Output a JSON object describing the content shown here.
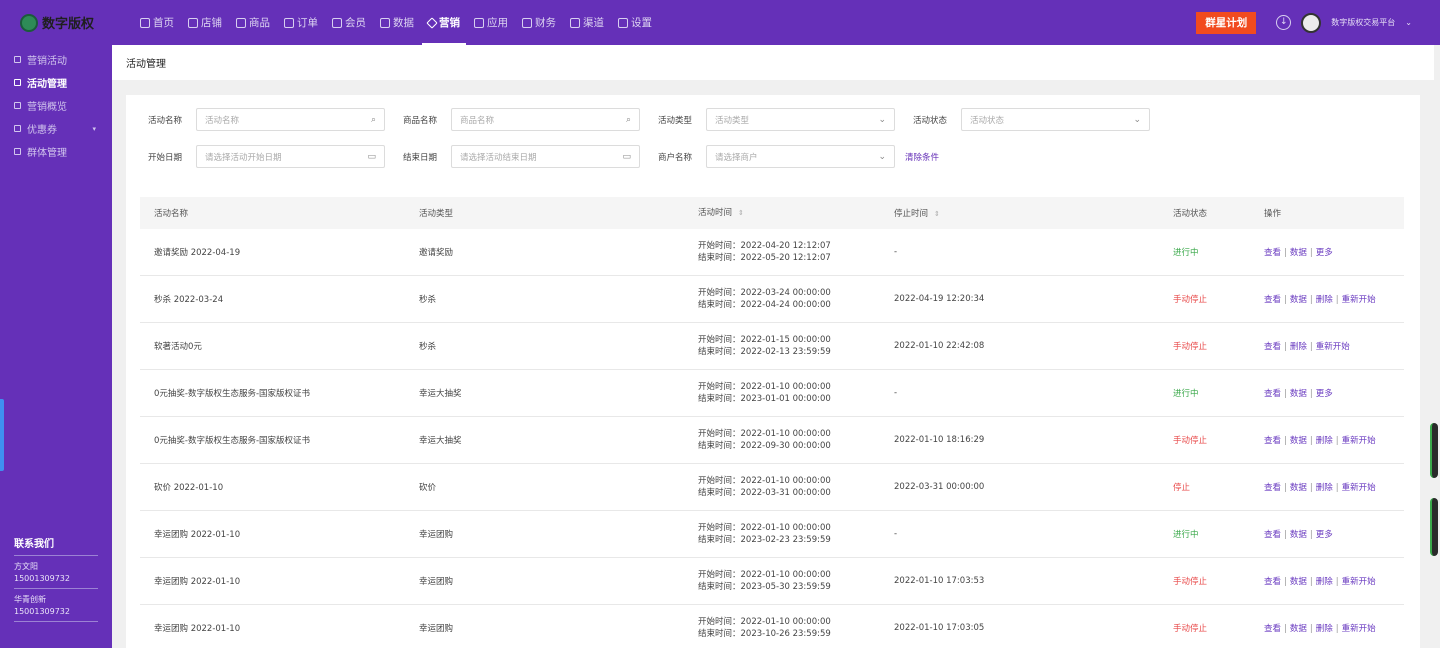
{
  "brand": {
    "name": "数字版权"
  },
  "nav": [
    {
      "label": "首页",
      "icon": "home-icon"
    },
    {
      "label": "店铺",
      "icon": "store-icon"
    },
    {
      "label": "商品",
      "icon": "goods-icon"
    },
    {
      "label": "订单",
      "icon": "order-icon"
    },
    {
      "label": "会员",
      "icon": "member-icon"
    },
    {
      "label": "数据",
      "icon": "data-icon"
    },
    {
      "label": "营销",
      "icon": "tag-icon",
      "active": true
    },
    {
      "label": "应用",
      "icon": "app-icon"
    },
    {
      "label": "财务",
      "icon": "finance-icon"
    },
    {
      "label": "渠道",
      "icon": "channel-icon"
    },
    {
      "label": "设置",
      "icon": "gear-icon"
    }
  ],
  "header_right": {
    "plan_button": "群星计划",
    "platform": "数字版权交易平台",
    "chevron": "⌄"
  },
  "sidebar": {
    "items": [
      {
        "label": "营销活动",
        "icon": "tag-icon"
      },
      {
        "label": "活动管理",
        "icon": "grid-icon",
        "active": true
      },
      {
        "label": "营销概览",
        "icon": "chart-icon"
      },
      {
        "label": "优惠券",
        "icon": "coupon-icon",
        "has_caret": true
      },
      {
        "label": "群体管理",
        "icon": "group-icon"
      }
    ],
    "contact": {
      "title": "联系我们",
      "people": [
        {
          "name": "方文阳",
          "phone": "15001309732"
        },
        {
          "name": "华青创新",
          "phone": "15001309732"
        }
      ]
    }
  },
  "page_title": "活动管理",
  "filters": {
    "row1": [
      {
        "label": "活动名称",
        "placeholder": "活动名称",
        "icon": "search-icon"
      },
      {
        "label": "商品名称",
        "placeholder": "商品名称",
        "icon": "search-icon"
      },
      {
        "label": "活动类型",
        "placeholder": "活动类型",
        "icon": "chevron-down-icon"
      },
      {
        "label": "活动状态",
        "placeholder": "活动状态",
        "icon": "chevron-down-icon"
      }
    ],
    "row2": [
      {
        "label": "开始日期",
        "placeholder": "请选择活动开始日期",
        "icon": "calendar-icon"
      },
      {
        "label": "结束日期",
        "placeholder": "请选择活动结束日期",
        "icon": "calendar-icon"
      },
      {
        "label": "商户名称",
        "placeholder": "请选择商户",
        "icon": "chevron-down-icon"
      }
    ],
    "clear": "清除条件"
  },
  "table": {
    "headers": [
      "活动名称",
      "活动类型",
      "活动时间",
      "停止时间",
      "活动状态",
      "操作"
    ],
    "rows": [
      {
        "name": "邀请奖励 2022-04-19",
        "type": "邀请奖励",
        "start": "开始时间：2022-04-20 12:12:07",
        "end": "结束时间：2022-05-20 12:12:07",
        "stop": "-",
        "status": "进行中",
        "status_kind": "run",
        "ops": [
          "查看",
          "数据",
          "更多"
        ]
      },
      {
        "name": "秒杀 2022-03-24",
        "type": "秒杀",
        "start": "开始时间：2022-03-24 00:00:00",
        "end": "结束时间：2022-04-24 00:00:00",
        "stop": "2022-04-19 12:20:34",
        "status": "手动停止",
        "status_kind": "stop",
        "ops": [
          "查看",
          "数据",
          "删除",
          "重新开始"
        ]
      },
      {
        "name": "软著活动0元",
        "type": "秒杀",
        "start": "开始时间：2022-01-15 00:00:00",
        "end": "结束时间：2022-02-13 23:59:59",
        "stop": "2022-01-10 22:42:08",
        "status": "手动停止",
        "status_kind": "stop",
        "ops": [
          "查看",
          "删除",
          "重新开始"
        ]
      },
      {
        "name": "0元抽奖-数字版权生态服务-国家版权证书",
        "type": "幸运大抽奖",
        "start": "开始时间：2022-01-10 00:00:00",
        "end": "结束时间：2023-01-01 00:00:00",
        "stop": "-",
        "status": "进行中",
        "status_kind": "run",
        "ops": [
          "查看",
          "数据",
          "更多"
        ]
      },
      {
        "name": "0元抽奖-数字版权生态服务-国家版权证书",
        "type": "幸运大抽奖",
        "start": "开始时间：2022-01-10 00:00:00",
        "end": "结束时间：2022-09-30 00:00:00",
        "stop": "2022-01-10 18:16:29",
        "status": "手动停止",
        "status_kind": "stop",
        "ops": [
          "查看",
          "数据",
          "删除",
          "重新开始"
        ]
      },
      {
        "name": "砍价 2022-01-10",
        "type": "砍价",
        "start": "开始时间：2022-01-10 00:00:00",
        "end": "结束时间：2022-03-31 00:00:00",
        "stop": "2022-03-31 00:00:00",
        "status": "停止",
        "status_kind": "stop",
        "ops": [
          "查看",
          "数据",
          "删除",
          "重新开始"
        ]
      },
      {
        "name": "幸运团购 2022-01-10",
        "type": "幸运团购",
        "start": "开始时间：2022-01-10 00:00:00",
        "end": "结束时间：2023-02-23 23:59:59",
        "stop": "-",
        "status": "进行中",
        "status_kind": "run",
        "ops": [
          "查看",
          "数据",
          "更多"
        ]
      },
      {
        "name": "幸运团购 2022-01-10",
        "type": "幸运团购",
        "start": "开始时间：2022-01-10 00:00:00",
        "end": "结束时间：2023-05-30 23:59:59",
        "stop": "2022-01-10 17:03:53",
        "status": "手动停止",
        "status_kind": "stop",
        "ops": [
          "查看",
          "数据",
          "删除",
          "重新开始"
        ]
      },
      {
        "name": "幸运团购 2022-01-10",
        "type": "幸运团购",
        "start": "开始时间：2022-01-10 00:00:00",
        "end": "结束时间：2023-10-26 23:59:59",
        "stop": "2022-01-10 17:03:05",
        "status": "手动停止",
        "status_kind": "stop",
        "ops": [
          "查看",
          "数据",
          "删除",
          "重新开始"
        ]
      }
    ]
  },
  "colors": {
    "brand": "#6530b8",
    "plan_button": "#f14b1f",
    "running": "#3aa84a",
    "stopped": "#e84a4a"
  }
}
